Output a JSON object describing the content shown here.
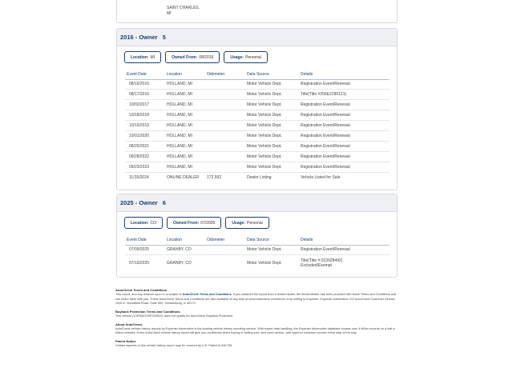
{
  "prev_card": {
    "location_line1": "SAINT CHARLES,",
    "location_line2": "MI"
  },
  "owner5": {
    "title_year": "2016 - Owner",
    "owner_no": "5",
    "location_label": "Location:",
    "location_value": "MI",
    "owned_label": "Owned From:",
    "owned_value": "08/2016",
    "usage_label": "Usage:",
    "usage_value": "Personal",
    "headers": [
      "Event Date",
      "Location",
      "Odometer",
      "Data Source",
      "Details"
    ],
    "rows": [
      [
        "08/16/2016",
        "HOLLAND, MI",
        "",
        "Motor Vehicle Dept.",
        "Registration Event/Renewal"
      ],
      [
        "08/17/2016",
        "HOLLAND, MI",
        "",
        "Motor Vehicle Dept.",
        "Title(Title #256E2290121)"
      ],
      [
        "10/02/2017",
        "HOLLAND, MI",
        "",
        "Motor Vehicle Dept.",
        "Registration Event/Renewal"
      ],
      [
        "10/18/2018",
        "HOLLAND, MI",
        "",
        "Motor Vehicle Dept.",
        "Registration Event/Renewal"
      ],
      [
        "10/15/2019",
        "HOLLAND, MI",
        "",
        "Motor Vehicle Dept.",
        "Registration Event/Renewal"
      ],
      [
        "10/01/2020",
        "HOLLAND, MI",
        "",
        "Motor Vehicle Dept.",
        "Registration Event/Renewal"
      ],
      [
        "08/25/2021",
        "HOLLAND, MI",
        "",
        "Motor Vehicle Dept.",
        "Registration Event/Renewal"
      ],
      [
        "09/28/2022",
        "HOLLAND, MI",
        "",
        "Motor Vehicle Dept.",
        "Registration Event/Renewal"
      ],
      [
        "09/23/2023",
        "HOLLAND, MI",
        "",
        "Motor Vehicle Dept.",
        "Registration Event/Renewal"
      ],
      [
        "11/15/2024",
        "ONLINE DEALER",
        "172,592",
        "Dealer Listing",
        "Vehicle Listed for Sale"
      ]
    ]
  },
  "owner6": {
    "title_year": "2025 - Owner",
    "owner_no": "6",
    "location_label": "Location:",
    "location_value": "CO",
    "owned_label": "Owned From:",
    "owned_value": "07/2025",
    "usage_label": "Usage:",
    "usage_value": "Personal",
    "headers": [
      "Event Date",
      "Location",
      "Odometer",
      "Data Source",
      "Details"
    ],
    "rows": [
      [
        "07/09/2025",
        "GRANBY, CO",
        "",
        "Motor Vehicle Dept.",
        "Registration Event/Renewal"
      ],
      [
        "07/10/2025",
        "GRANBY, CO",
        "",
        "Motor Vehicle Dept.",
        "Title(Title #:013928492)",
        "Excluded/Exempt"
      ]
    ]
  },
  "legal": {
    "terms_title": "AutoCheck Terms and Conditions",
    "terms_text_a": "This report, and any reliance upon it, is subject to",
    "terms_link": "AutoCheck Terms and Conditions",
    "terms_text_b": ". If you obtained the report from a lender/dealer, the lender/dealer has been provided with these Terms and Conditions and can share them with you. These AutoCheck Terms and Conditions are also available at any time at www.autocheck.com/terms or by writing to Experian: Experian Automotive C/O AutoCheck Customer Service 1515 E. Woodfield Road, Suite 500, Schaumburg, IL 60173.",
    "buyback_title": "Buyback Protection Terms and Conditions",
    "buyback_text": "This vehicle (1J4PA5GS9FS02620) does not qualify for AutoCheck Buyback Protection.",
    "about_title": "About AutoCheck",
    "about_text": "AutoCheck vehicle history reports by Experian Automotive is the leading vehicle history reporting service. With expert data handling, the Experian Automotive database houses over 4 billion records on a half a billion vehicles. Every AutoCheck vehicle history report will give you confidence when buying or selling your next used vehicle, with superior customer service every step of the way.",
    "patent_title": "Patent Notice",
    "patent_text": "Certain aspects of this vehicle history report may be covered by U.S. Patent 8,005,759."
  }
}
